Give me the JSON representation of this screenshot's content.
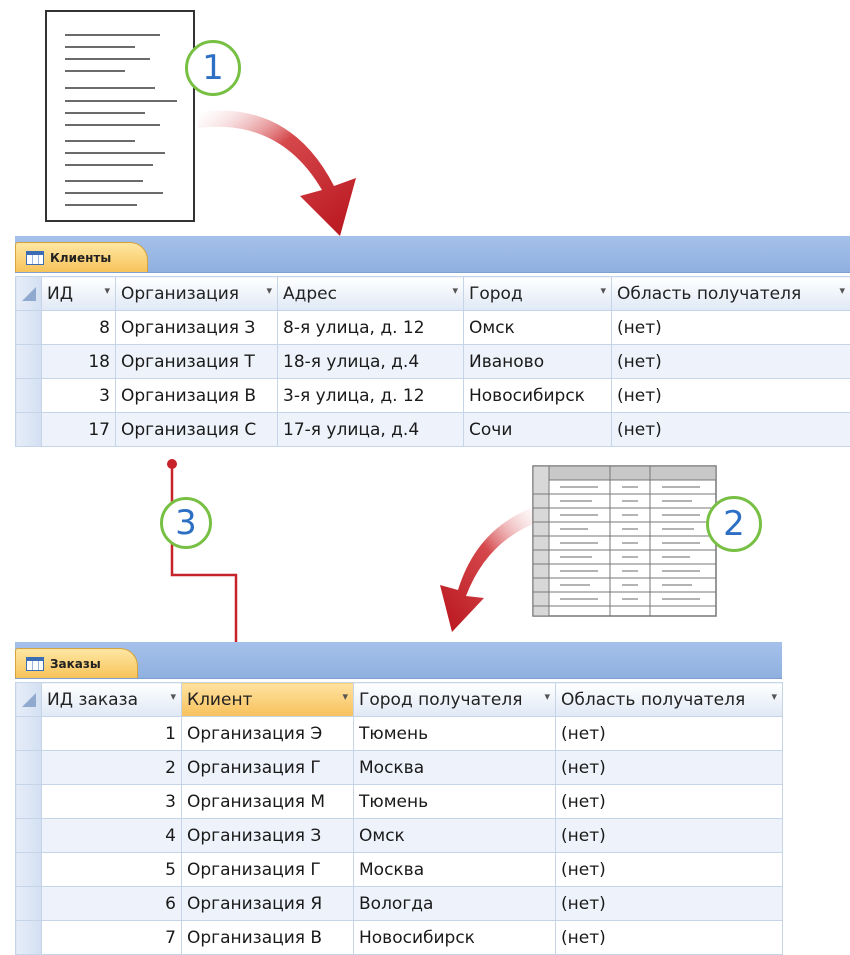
{
  "callouts": {
    "one": "1",
    "two": "2",
    "three": "3"
  },
  "customers": {
    "tab": "Клиенты",
    "headers": [
      "ИД",
      "Организация",
      "Адрес",
      "Город",
      "Область получателя"
    ],
    "rows": [
      [
        "8",
        "Организация З",
        "8-я улица, д. 12",
        "Омск",
        "(нет)"
      ],
      [
        "18",
        "Организация Т",
        "18-я улица, д.4",
        "Иваново",
        "(нет)"
      ],
      [
        "3",
        "Организация В",
        "3-я улица, д. 12",
        "Новосибирск",
        "(нет)"
      ],
      [
        "17",
        "Организация С",
        "17-я улица, д.4",
        "Сочи",
        "(нет)"
      ]
    ]
  },
  "orders": {
    "tab": "Заказы",
    "headers": [
      "ИД заказа",
      "Клиент",
      "Город получателя",
      "Область получателя"
    ],
    "rows": [
      [
        "1",
        "Организация Э",
        "Тюмень",
        "(нет)"
      ],
      [
        "2",
        "Организация Г",
        "Москва",
        "(нет)"
      ],
      [
        "3",
        "Организация М",
        "Тюмень",
        "(нет)"
      ],
      [
        "4",
        "Организация З",
        "Омск",
        "(нет)"
      ],
      [
        "5",
        "Организация Г",
        "Москва",
        "(нет)"
      ],
      [
        "6",
        "Организация Я",
        "Вологда",
        "(нет)"
      ],
      [
        "7",
        "Организация В",
        "Новосибирск",
        "(нет)"
      ]
    ]
  },
  "colors": {
    "arrow": "#c8232a",
    "badge_ring": "#77c044",
    "badge_text": "#2d6fc4",
    "tab": "#f7c35a",
    "header_bar": "#9ab8e6"
  }
}
